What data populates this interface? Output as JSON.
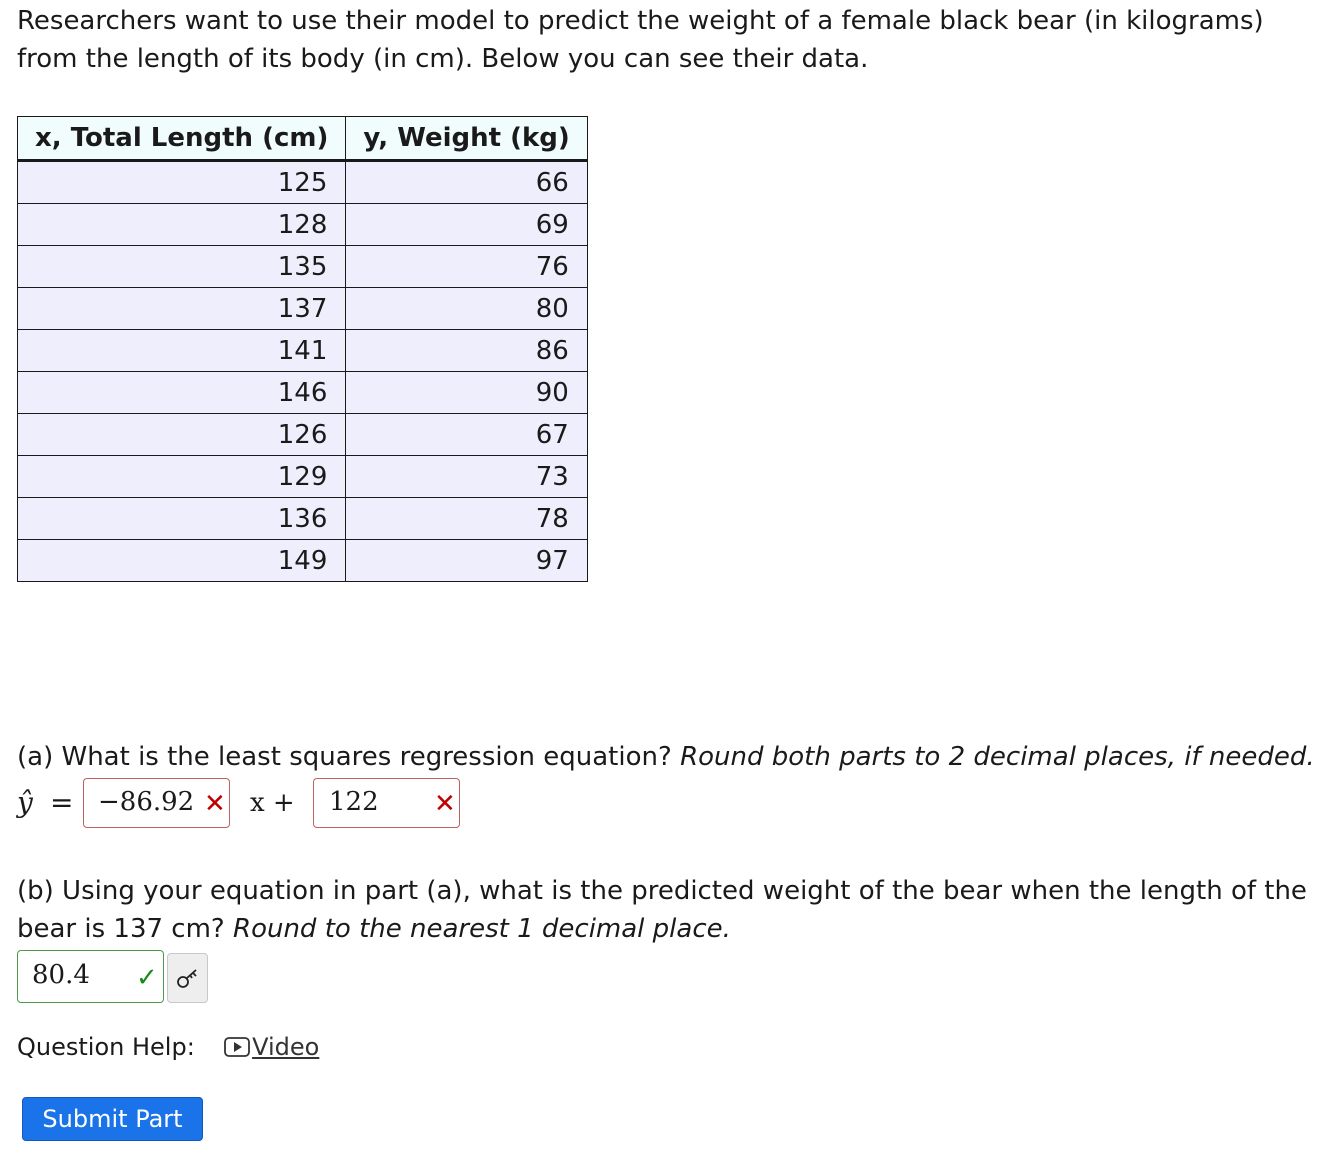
{
  "intro": "Researchers want to use their model to predict the weight of a female black bear (in kilograms) from the length of its body (in cm). Below you can see their data.",
  "table": {
    "headers": [
      "x, Total Length (cm)",
      "y, Weight (kg)"
    ],
    "rows": [
      [
        "125",
        "66"
      ],
      [
        "128",
        "69"
      ],
      [
        "135",
        "76"
      ],
      [
        "137",
        "80"
      ],
      [
        "141",
        "86"
      ],
      [
        "146",
        "90"
      ],
      [
        "126",
        "67"
      ],
      [
        "129",
        "73"
      ],
      [
        "136",
        "78"
      ],
      [
        "149",
        "97"
      ]
    ]
  },
  "part_a": {
    "question": "(a) What is the least squares regression equation?",
    "instruction": "Round both parts to 2 decimal places, if needed.",
    "lhs": "ŷ",
    "equals": "=",
    "slope_value": "−86.92",
    "middle": "x +",
    "intercept_value": "122",
    "slope_status": "incorrect",
    "intercept_status": "incorrect"
  },
  "part_b": {
    "question": "(b) Using your equation in part (a), what is the predicted weight of the bear when the length of the bear is 137 cm?",
    "instruction": "Round to the nearest 1 decimal place.",
    "answer_value": "80.4",
    "answer_status": "correct"
  },
  "help": {
    "label": "Question Help:",
    "link": "Video"
  },
  "submit_label": "Submit Part",
  "colors": {
    "incorrect": "#c00000",
    "correct": "#1a8a1a",
    "button": "#1a73e8",
    "header_bg": "#f1fdfd",
    "cell_bg": "#eeeefc"
  },
  "icons": {
    "incorrect": "x-icon",
    "correct": "check-icon",
    "key": "key-icon",
    "video": "play-icon"
  }
}
